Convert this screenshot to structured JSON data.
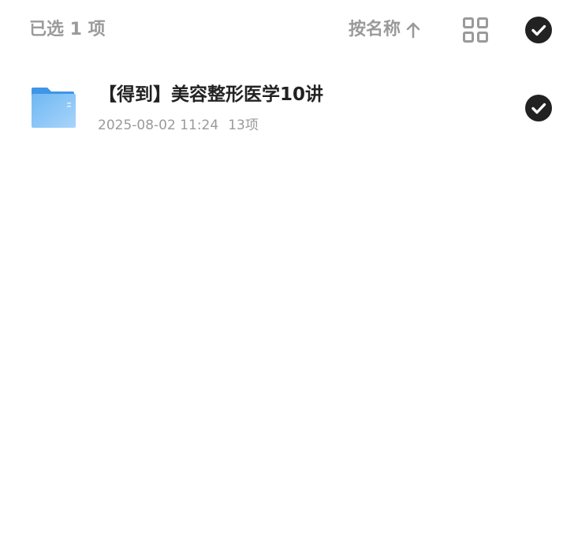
{
  "header": {
    "selected_label": "已选 1 项",
    "sort_label": "按名称",
    "sort_icon": "arrow-up-icon",
    "view_toggle_icon": "grid-view-icon",
    "select_all_icon": "check-circle-icon"
  },
  "files": [
    {
      "name": "【得到】美容整形医学10讲",
      "modified": "2025-08-02 11:24",
      "item_count": "13项",
      "icon": "folder-icon",
      "selected": true
    }
  ],
  "colors": {
    "text_primary": "#222222",
    "text_secondary": "#9a9a9a",
    "check_fill": "#222222",
    "folder_blue": "#5aaef0",
    "background": "#ffffff"
  }
}
